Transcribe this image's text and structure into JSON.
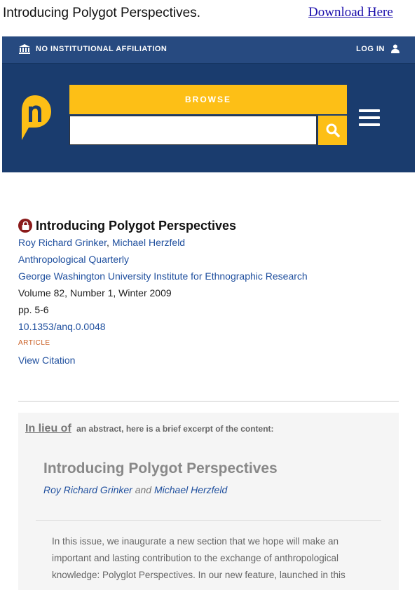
{
  "topbar": {
    "title": "Introducing Polygot Perspectives.",
    "download_label": "Download Here"
  },
  "header": {
    "affiliation": "NO INSTITUTIONAL AFFILIATION",
    "login": "LOG IN",
    "browse_label": "BROWSE",
    "search_placeholder": ""
  },
  "article": {
    "title": "Introducing Polygot Perspectives",
    "author1": "Roy Richard Grinker",
    "author_sep": ",",
    "author2": "Michael Herzfeld",
    "journal": "Anthropological Quarterly",
    "publisher": "George Washington University Institute for Ethnographic Research",
    "volume": "Volume 82, Number 1, Winter 2009",
    "pages": "pp. 5-6",
    "doi": "10.1353/anq.0.0048",
    "type": "ARTICLE",
    "citation_label": "View Citation"
  },
  "excerpt": {
    "lead_strong": "In lieu of",
    "lead_rest": "an abstract, here is a brief excerpt of the content:",
    "title": "Introducing Polygot Perspectives",
    "author1": "Roy Richard Grinker",
    "and": "and",
    "author2": "Michael Herzfeld",
    "body": "In this issue, we inaugurate a new section that we hope will make an important and lasting contribution to the exchange of anthropological knowledge: Polyglot Perspectives. In our new feature, launched in this"
  },
  "colors": {
    "header_bg": "#1a3c6e",
    "accent_yellow": "#fdbf16",
    "link_blue": "#1f4f9e",
    "lock_red": "#8a1a1a"
  },
  "icons": [
    "institution-icon",
    "user-icon",
    "muse-logo",
    "search-icon",
    "hamburger-menu-icon",
    "lock-icon"
  ]
}
